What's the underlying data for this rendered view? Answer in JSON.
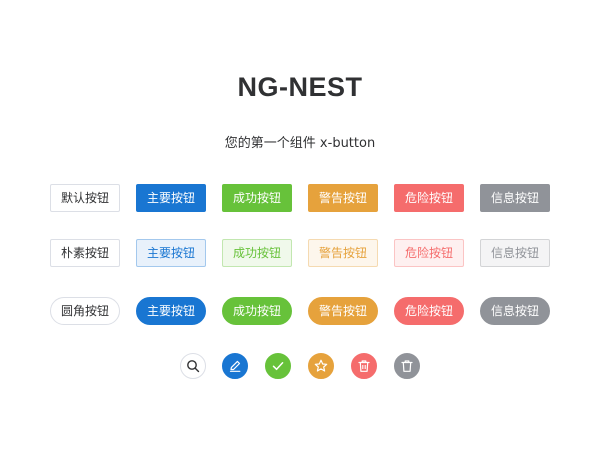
{
  "header": {
    "title": "NG-NEST",
    "subtitle": "您的第一个组件 x-button"
  },
  "rows": {
    "solid": [
      "默认按钮",
      "主要按钮",
      "成功按钮",
      "警告按钮",
      "危险按钮",
      "信息按钮"
    ],
    "plain": [
      "朴素按钮",
      "主要按钮",
      "成功按钮",
      "警告按钮",
      "危险按钮",
      "信息按钮"
    ],
    "round": [
      "圆角按钮",
      "主要按钮",
      "成功按钮",
      "警告按钮",
      "危险按钮",
      "信息按钮"
    ]
  },
  "icon_buttons": [
    "search-icon",
    "edit-icon",
    "check-icon",
    "star-icon",
    "delete-icon",
    "trash-icon"
  ],
  "colors": {
    "primary": "#1976d2",
    "success": "#67c23a",
    "warning": "#e6a23c",
    "danger": "#f56c6c",
    "info": "#909399",
    "text": "#303133",
    "border": "#dcdfe6"
  }
}
